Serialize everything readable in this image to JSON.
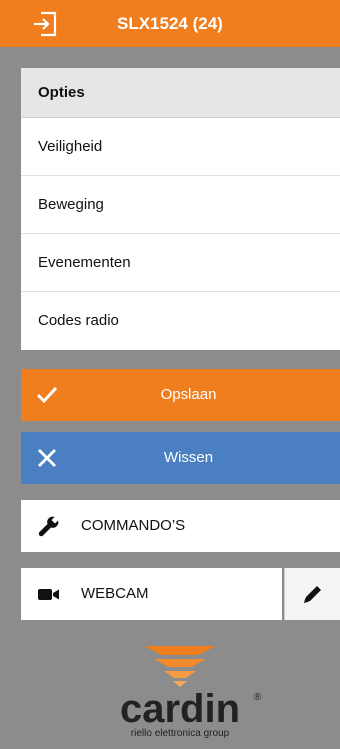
{
  "header": {
    "title": "SLX1524 (24)",
    "exit_icon": "exit-icon",
    "color": "#f07d1e"
  },
  "menu": {
    "heading": "Opties",
    "items": [
      {
        "label": "Veiligheid"
      },
      {
        "label": "Beweging"
      },
      {
        "label": "Evenementen"
      },
      {
        "label": "Codes radio"
      }
    ]
  },
  "actions": {
    "save": {
      "label": "Opslaan",
      "icon": "check-icon",
      "color": "#f07d1e"
    },
    "clear": {
      "label": "Wissen",
      "icon": "close-icon",
      "color": "#4a7fc1"
    }
  },
  "commands": {
    "label": "COMMANDO’S",
    "icon": "wrench-icon"
  },
  "webcam": {
    "label": "WEBCAM",
    "icon": "video-camera-icon",
    "edit_icon": "pencil-icon"
  },
  "logo": {
    "brand": "cardin",
    "tagline": "riello elettronica group",
    "mark": "®"
  }
}
